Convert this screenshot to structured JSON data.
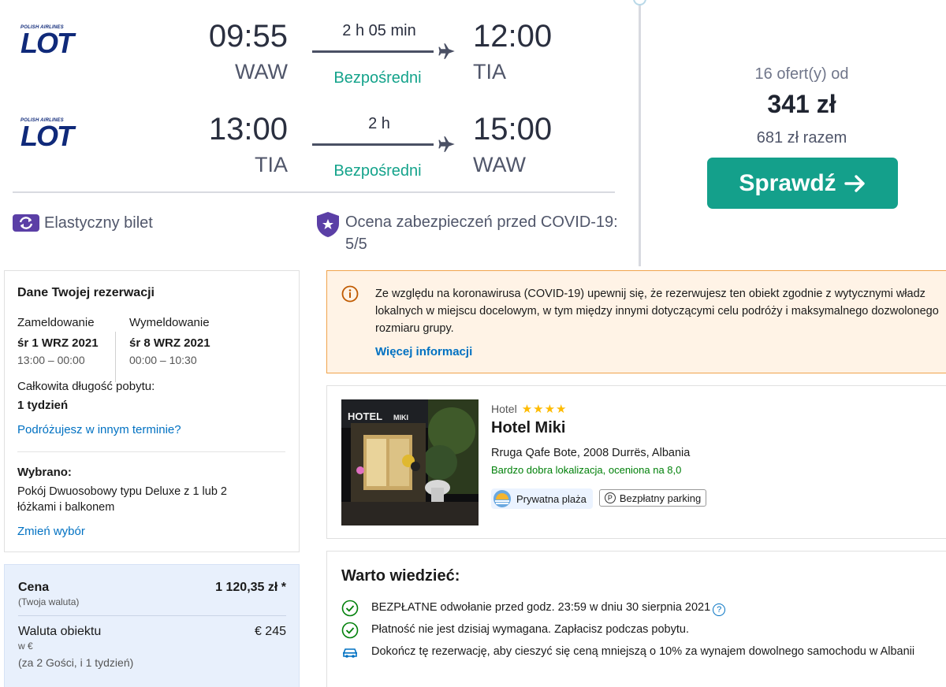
{
  "flight": {
    "airline": {
      "small_text": "POLISH AIRLINES",
      "logo_text": "LOT"
    },
    "legs": [
      {
        "dep_time": "09:55",
        "dep_airport": "WAW",
        "duration": "2 h 05 min",
        "stops": "Bezpośredni",
        "arr_time": "12:00",
        "arr_airport": "TIA"
      },
      {
        "dep_time": "13:00",
        "dep_airport": "TIA",
        "duration": "2 h",
        "stops": "Bezpośredni",
        "arr_time": "15:00",
        "arr_airport": "WAW"
      }
    ],
    "flexible_ticket": "Elastyczny bilet",
    "covid_rating": "Ocena zabezpieczeń przed COVID-19: 5/5",
    "offers": "16 ofert(y) od",
    "price": "341 zł",
    "total": "681 zł razem",
    "check_button": "Sprawdź",
    "colors": {
      "accent": "#14a08b",
      "brand": "#102a7a",
      "flex_icon": "#5b3fa6"
    }
  },
  "booking": {
    "title": "Dane Twojej rezerwacji",
    "checkin": {
      "label": "Zameldowanie",
      "date": "śr 1 WRZ 2021",
      "hours": "13:00 – 00:00"
    },
    "checkout": {
      "label": "Wymeldowanie",
      "date": "śr 8 WRZ 2021",
      "hours": "00:00 – 10:30"
    },
    "stay_label": "Całkowita długość pobytu:",
    "stay_value": "1 tydzień",
    "other_dates": "Podróżujesz w innym terminie?",
    "selected_label": "Wybrano:",
    "room": "Pokój Dwuosobowy typu Deluxe z 1 lub 2 łóżkami i balkonem",
    "change": "Zmień wybór"
  },
  "price_panel": {
    "price_label": "Cena",
    "price_value": "1 120,35 zł *",
    "price_sub": "(Twoja waluta)",
    "local_label": "Waluta obiektu",
    "local_value": "€ 245",
    "local_sub": "w €",
    "guests": "(za 2 Gości,   i 1 tydzień)"
  },
  "covid_notice": {
    "text": "Ze względu na koronawirusa (COVID-19) upewnij się, że rezerwujesz ten obiekt zgodnie z wytycznymi władz lokalnych w miejscu docelowym, w tym między innymi dotyczącymi celu podróży i maksymalnego dozwolonego rozmiaru grupy.",
    "more_info": "Więcej informacji"
  },
  "hotel": {
    "type": "Hotel",
    "stars": "★★★★",
    "name": "Hotel Miki",
    "address": "Rruga Qafe Bote, 2008 Durrës, Albania",
    "location_rating": "Bardzo dobra lokalizacja, oceniona na 8,0",
    "badges": {
      "beach": "Prywatna plaża",
      "parking": "Bezpłatny parking"
    },
    "photo_sign": "HOTEL",
    "photo_sign2": "MIKI"
  },
  "good_to_know": {
    "title": "Warto wiedzieć:",
    "items": [
      "BEZPŁATNE odwołanie przed godz. 23:59 w dniu 30 sierpnia 2021",
      "Płatność nie jest dzisiaj wymagana. Zapłacisz podczas pobytu.",
      "Dokończ tę rezerwację, aby cieszyć się ceną mniejszą o 10% za wynajem dowolnego samochodu w Albanii"
    ]
  }
}
